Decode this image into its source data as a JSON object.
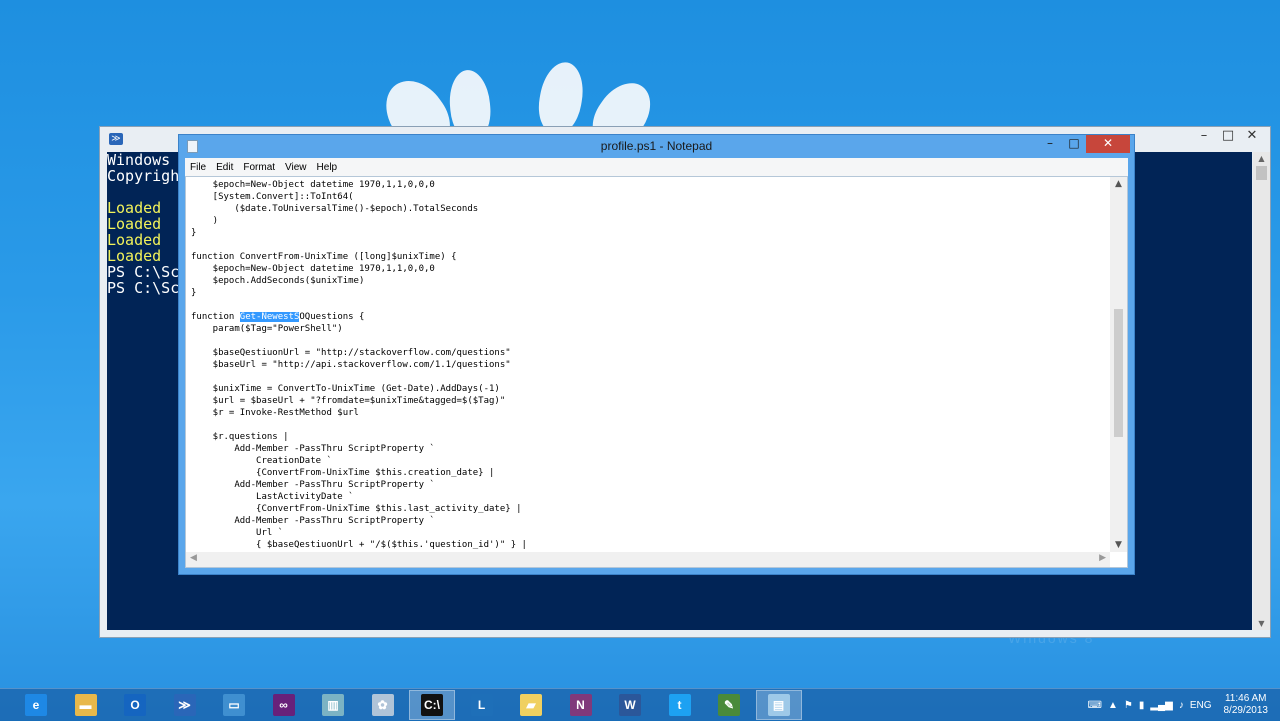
{
  "desktop": {
    "watermark": "Windows 8"
  },
  "powershell": {
    "lines": [
      {
        "text": "Windows ",
        "color": "#ffffff"
      },
      {
        "text": "Copyrigh",
        "color": "#ffffff"
      },
      {
        "text": "",
        "color": "#ffffff"
      },
      {
        "text": "Loaded ",
        "color": "#f2f25a"
      },
      {
        "text": "Loaded ",
        "color": "#f2f25a"
      },
      {
        "text": "Loaded ",
        "color": "#f2f25a"
      },
      {
        "text": "Loaded ",
        "color": "#f2f25a"
      },
      {
        "text": "PS C:\\Sc",
        "color": "#ffffff"
      },
      {
        "text": "PS C:\\Sc",
        "color": "#ffffff"
      }
    ]
  },
  "notepad": {
    "title": "profile.ps1 - Notepad",
    "menu": [
      "File",
      "Edit",
      "Format",
      "View",
      "Help"
    ],
    "code": [
      "    $epoch=New-Object datetime 1970,1,1,0,0,0",
      "    [System.Convert]::ToInt64(",
      "        ($date.ToUniversalTime()-$epoch).TotalSeconds",
      "    )",
      "}",
      "",
      "function ConvertFrom-UnixTime ([long]$unixTime) {",
      "    $epoch=New-Object datetime 1970,1,1,0,0,0",
      "    $epoch.AddSeconds($unixTime)",
      "}",
      "",
      "function Get-NewestSOQuestions {",
      "    param($Tag=\"PowerShell\")",
      "",
      "    $baseQestiuonUrl = \"http://stackoverflow.com/questions\"",
      "    $baseUrl = \"http://api.stackoverflow.com/1.1/questions\"",
      "",
      "    $unixTime = ConvertTo-UnixTime (Get-Date).AddDays(-1)",
      "    $url = $baseUrl + \"?fromdate=$unixTime&tagged=$($Tag)\"",
      "    $r = Invoke-RestMethod $url",
      "",
      "    $r.questions |",
      "        Add-Member -PassThru ScriptProperty `",
      "            CreationDate `",
      "            {ConvertFrom-UnixTime $this.creation_date} |",
      "        Add-Member -PassThru ScriptProperty `",
      "            LastActivityDate `",
      "            {ConvertFrom-UnixTime $this.last_activity_date} |",
      "        Add-Member -PassThru ScriptProperty `",
      "            Url `",
      "            { $baseQestiuonUrl + \"/$($this.'question_id')\" } |"
    ],
    "selection": {
      "line": 11,
      "before": "function ",
      "selected": "Get-NewestS",
      "after": "OQuestions {"
    }
  },
  "taskbar": {
    "apps": [
      {
        "name": "internet-explorer-icon",
        "glyph": "e",
        "color": "#1e88e5",
        "active": false
      },
      {
        "name": "file-explorer-icon",
        "glyph": "▬",
        "color": "#e8b84a",
        "active": false
      },
      {
        "name": "outlook-icon",
        "glyph": "O",
        "color": "#1565c0",
        "active": false
      },
      {
        "name": "powershell-icon",
        "glyph": "≫",
        "color": "#2a66b8",
        "active": false
      },
      {
        "name": "remote-desktop-icon",
        "glyph": "▭",
        "color": "#3f8fd0",
        "active": false
      },
      {
        "name": "visual-studio-icon",
        "glyph": "∞",
        "color": "#68217a",
        "active": false
      },
      {
        "name": "building-icon",
        "glyph": "▥",
        "color": "#7bb3c4",
        "active": false
      },
      {
        "name": "network-tool-icon",
        "glyph": "✿",
        "color": "#b0c4d8",
        "active": false
      },
      {
        "name": "command-prompt-icon",
        "glyph": "C:\\",
        "color": "#111111",
        "active": true
      },
      {
        "name": "lync-icon",
        "glyph": "L",
        "color": "#1e6fb8",
        "active": false
      },
      {
        "name": "folder-icon",
        "glyph": "▰",
        "color": "#f0d060",
        "active": false
      },
      {
        "name": "onenote-icon",
        "glyph": "N",
        "color": "#80397b",
        "active": false
      },
      {
        "name": "word-icon",
        "glyph": "W",
        "color": "#2b579a",
        "active": false
      },
      {
        "name": "twitter-icon",
        "glyph": "t",
        "color": "#1da1f2",
        "active": false
      },
      {
        "name": "chart-tool-icon",
        "glyph": "✎",
        "color": "#4a8a3a",
        "active": false
      },
      {
        "name": "notepad-icon",
        "glyph": "▤",
        "color": "#9ec9e8",
        "active": true
      }
    ],
    "lang": "ENG",
    "time": "11:46 AM",
    "date": "8/29/2013"
  }
}
